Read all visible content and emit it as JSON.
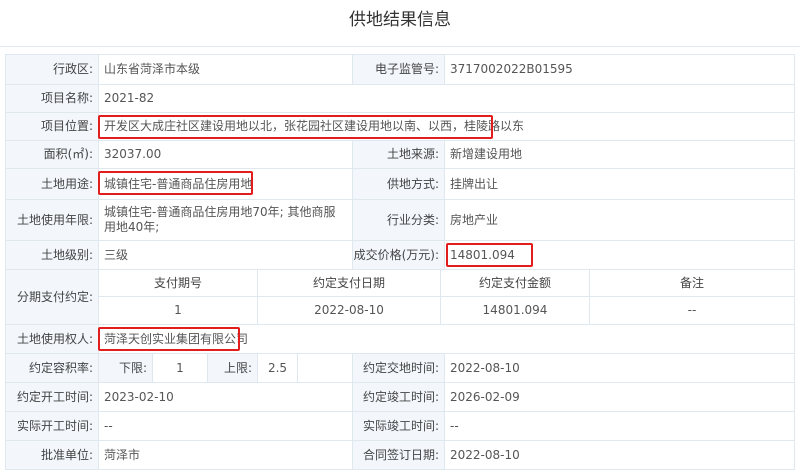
{
  "title": "供地结果信息",
  "row1": {
    "l1": "行政区:",
    "v1": "山东省菏泽市本级",
    "l2": "电子监管号:",
    "v2": "3717002022B01595"
  },
  "row2": {
    "l1": "项目名称:",
    "v1": "2021-82"
  },
  "row3": {
    "l1": "项目位置:",
    "v1": "开发区大成庄社区建设用地以北，张花园社区建设用地以南、以西，桂陵路以东"
  },
  "row4": {
    "l1": "面积(㎡):",
    "v1": "32037.00",
    "l2": "土地来源:",
    "v2": "新增建设用地"
  },
  "row5": {
    "l1": "土地用途:",
    "v1": "城镇住宅-普通商品住房用地",
    "l2": "供地方式:",
    "v2": "挂牌出让"
  },
  "row6": {
    "l1": "土地使用年限:",
    "v1": "城镇住宅-普通商品住房用地70年; 其他商服用地40年;",
    "l2": "行业分类:",
    "v2": "房地产业"
  },
  "row7": {
    "l1": "土地级别:",
    "v1": "三级",
    "l2": "成交价格(万元):",
    "v2": "14801.094"
  },
  "installment": {
    "label": "分期支付约定:",
    "headers": [
      "支付期号",
      "约定支付日期",
      "约定支付金额",
      "备注"
    ],
    "row": [
      "1",
      "2022-08-10",
      "14801.094",
      "--"
    ]
  },
  "row9": {
    "l1": "土地使用权人:",
    "v1": "菏泽天创实业集团有限公司"
  },
  "row10": {
    "l1": "约定容积率:",
    "lower_label": "下限:",
    "lower": "1",
    "upper_label": "上限:",
    "upper": "2.5",
    "l2": "约定交地时间:",
    "v2": "2022-08-10"
  },
  "row11": {
    "l1": "约定开工时间:",
    "v1": "2023-02-10",
    "l2": "约定竣工时间:",
    "v2": "2026-02-09"
  },
  "row12": {
    "l1": "实际开工时间:",
    "v1": "--",
    "l2": "实际竣工时间:",
    "v2": "--"
  },
  "row13": {
    "l1": "批准单位:",
    "v1": "菏泽市",
    "l2": "合同签订日期:",
    "v2": "2022-08-10"
  },
  "colors": {
    "highlight": "#e21d1d",
    "label_bg": "#f3f7fc",
    "border": "#dfe7ef"
  }
}
